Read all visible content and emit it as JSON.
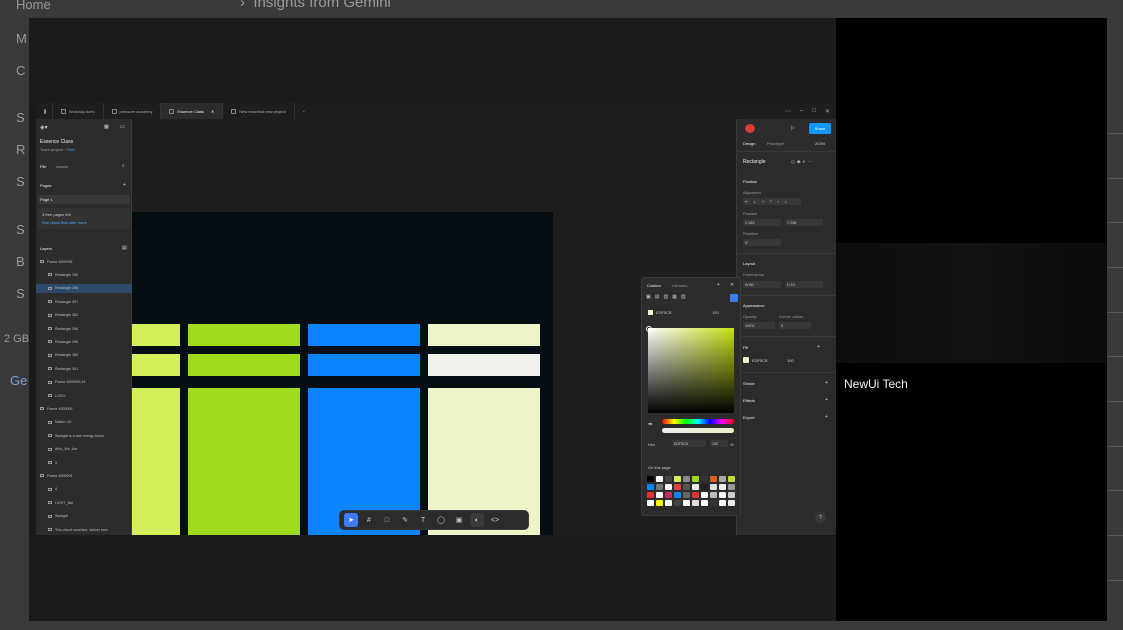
{
  "background_page": {
    "header_text": "Insights from Gemini",
    "left_items": [
      "Home",
      "M",
      "C",
      "S",
      "R",
      "S",
      "S",
      "B",
      "S",
      "2 GB",
      "Ge"
    ]
  },
  "participant": {
    "name": "NewUi Tech"
  },
  "figma": {
    "tabs": [
      {
        "label": "Workday Aces",
        "active": false
      },
      {
        "label": "pressure academy",
        "active": false
      },
      {
        "label": "Essence Class",
        "active": true
      },
      {
        "label": "New essential new project",
        "active": false
      }
    ],
    "file": {
      "name": "Essence Class",
      "subtitle": "Team project",
      "badge": "Free",
      "tabs": [
        "File",
        "Assets"
      ],
      "pages_label": "Pages",
      "page": "Page 1",
      "notice_line1": "3 free pages left",
      "notice_line2": "See plans that offer more",
      "layers_label": "Layers"
    },
    "layers": [
      {
        "label": "Frame 4000008",
        "selected": false,
        "depth": 0
      },
      {
        "label": "Rectangle 398",
        "selected": false,
        "depth": 1
      },
      {
        "label": "Rectangle 398",
        "selected": true,
        "depth": 1
      },
      {
        "label": "Rectangle 397",
        "selected": false,
        "depth": 1
      },
      {
        "label": "Rectangle 362",
        "selected": false,
        "depth": 1
      },
      {
        "label": "Rectangle 396",
        "selected": false,
        "depth": 1
      },
      {
        "label": "Rectangle 395",
        "selected": false,
        "depth": 1
      },
      {
        "label": "Rectangle 365",
        "selected": false,
        "depth": 1
      },
      {
        "label": "Rectangle 361",
        "selected": false,
        "depth": 1
      },
      {
        "label": "Frame 4000083.24",
        "selected": false,
        "depth": 1
      },
      {
        "label": "LOGO",
        "selected": false,
        "depth": 1
      },
      {
        "label": "Frame 4000009",
        "selected": false,
        "depth": 0
      },
      {
        "label": "Nation .02",
        "selected": false,
        "depth": 1
      },
      {
        "label": "Sunlight is a rare energy boost",
        "selected": false,
        "depth": 1
      },
      {
        "label": "Who_We_Are",
        "selected": false,
        "depth": 1
      },
      {
        "label": "3",
        "selected": false,
        "depth": 1
      },
      {
        "label": "Frame 4000004",
        "selected": false,
        "depth": 0
      },
      {
        "label": "4",
        "selected": false,
        "depth": 1
      },
      {
        "label": "LIGHT_Bar",
        "selected": false,
        "depth": 1
      },
      {
        "label": "Sunlight",
        "selected": false,
        "depth": 1
      },
      {
        "label": "This visual sunshine, deliver mov",
        "selected": false,
        "depth": 1
      }
    ],
    "right": {
      "share": "Share",
      "tabs": [
        "Design",
        "Prototype"
      ],
      "zoom": "203%",
      "selection": "Rectangle",
      "position_label": "Position",
      "alignment_label": "Alignment",
      "position_fields": [
        "X 283",
        "Y 208"
      ],
      "rotation_label": "Rotation",
      "rotation_field": "0°",
      "layout_label": "Layout",
      "dimensions_label": "Dimensions",
      "dimension_fields": [
        "W 80",
        "H 10"
      ],
      "appearance_label": "Appearance",
      "opacity_label": "Opacity",
      "opacity_value": "100%",
      "corner_label": "Corner radius",
      "corner_value": "0",
      "fill_label": "Fill",
      "fill_hex": "EDF5C8",
      "fill_opacity": "100",
      "stroke_label": "Stroke",
      "effects_label": "Effects",
      "export_label": "Export"
    },
    "picker": {
      "tabs": [
        "Custom",
        "Libraries"
      ],
      "mode": "Hex",
      "hex": "EDF5C8",
      "opacity": "100",
      "percent": "%",
      "on_this_page": "On this page",
      "top_value": "100"
    }
  },
  "colors": {
    "lime_light": "#d3ef5a",
    "lime": "#9fdc1e",
    "blue": "#0a84ff",
    "cream": "#edf5c8",
    "frame_bg": "#050e12",
    "accent": "#0d99ff"
  }
}
